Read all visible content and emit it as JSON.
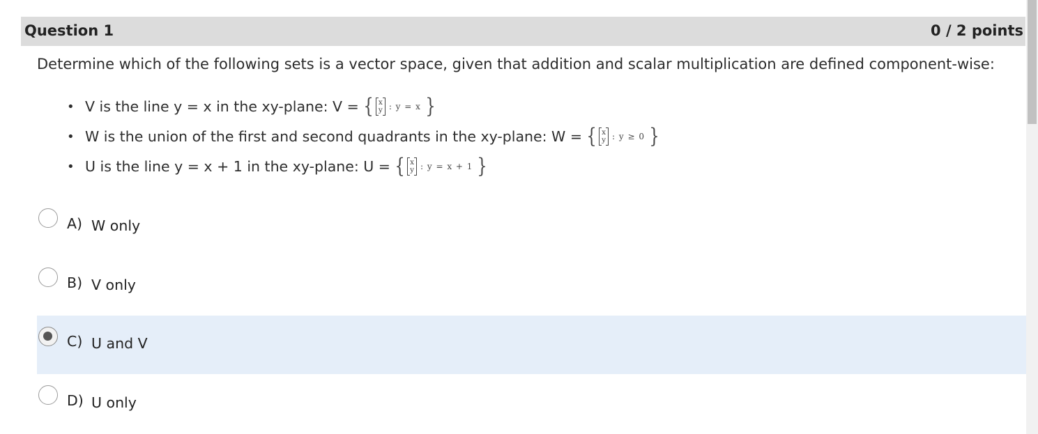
{
  "question": {
    "title": "Question 1",
    "points": "0 / 2 points",
    "prompt": "Determine which of the following sets is a vector space, given that addition and scalar multiplication are defined component-wise:"
  },
  "bullets": [
    {
      "text": "V is the line y = x in the xy-plane: V =",
      "vec_top": "x",
      "vec_bottom": "y",
      "condition": ": y = x"
    },
    {
      "text": "W is the union of the first and second quadrants in the xy-plane: W =",
      "vec_top": "x",
      "vec_bottom": "y",
      "condition": ": y ≥ 0"
    },
    {
      "text": "U is the line y = x + 1 in the xy-plane: U =",
      "vec_top": "x",
      "vec_bottom": "y",
      "condition": ": y = x + 1"
    }
  ],
  "brace_open": "{",
  "brace_close": "}",
  "options": [
    {
      "letter": "A)",
      "text": "W only",
      "selected": false
    },
    {
      "letter": "B)",
      "text": "V only",
      "selected": false
    },
    {
      "letter": "C)",
      "text": "U and V",
      "selected": true
    },
    {
      "letter": "D)",
      "text": "U only",
      "selected": false
    }
  ],
  "colors": {
    "header_bg": "#dcdcdc",
    "selected_bg": "#e5eef9",
    "radio_fill": "#555555"
  }
}
